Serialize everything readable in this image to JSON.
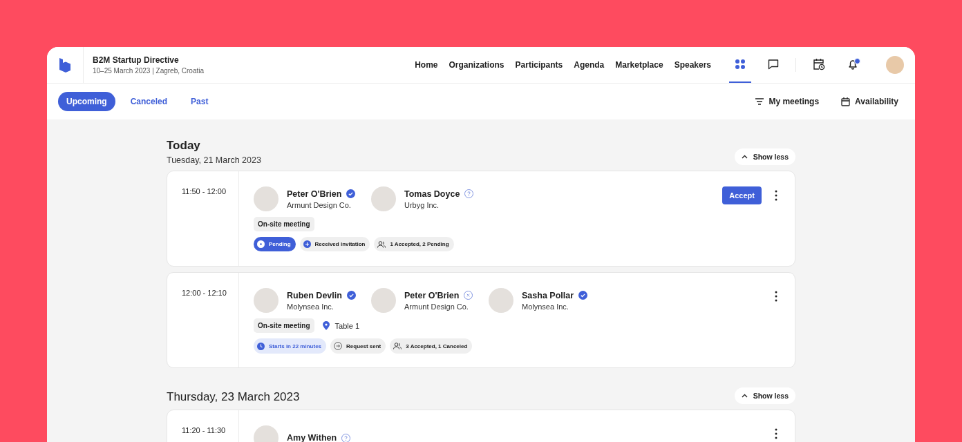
{
  "header": {
    "event_title": "B2M Startup Directive",
    "event_subtitle": "10–25 March 2023 | Zagreb, Croatia",
    "nav": [
      {
        "label": "Home"
      },
      {
        "label": "Organizations"
      },
      {
        "label": "Participants"
      },
      {
        "label": "Agenda"
      },
      {
        "label": "Marketplace"
      },
      {
        "label": "Speakers"
      }
    ],
    "icons": [
      {
        "kind": "grid",
        "selected": true,
        "badge": false
      },
      {
        "kind": "chat",
        "selected": false,
        "badge": false
      },
      {
        "kind": "calendar-clock",
        "selected": false,
        "badge": false
      },
      {
        "kind": "bell",
        "selected": false,
        "badge": true
      }
    ]
  },
  "tabs": [
    {
      "label": "Upcoming",
      "selected": true
    },
    {
      "label": "Canceled",
      "selected": false
    },
    {
      "label": "Past",
      "selected": false
    }
  ],
  "filters": [
    {
      "kind": "filter",
      "label": "My meetings"
    },
    {
      "kind": "calendar",
      "label": "Availability"
    }
  ],
  "sections": [
    {
      "kind": "today",
      "title": "Today",
      "subtitle": "Tuesday, 21 March 2023",
      "toggle": "Show less",
      "meetings": [
        {
          "time": "11:50 - 12:00",
          "participants": [
            {
              "name": "Peter O'Brien",
              "org": "Armunt Design Co.",
              "kind": "confirmed"
            },
            {
              "name": "Tomas Doyce",
              "org": "Urbyg Inc.",
              "kind": "pending"
            }
          ],
          "type": "On-site meeting",
          "chips": [
            {
              "kind": "pending",
              "label": "Pending"
            },
            {
              "kind": "invite",
              "label": "Received invitation"
            },
            {
              "kind": "people",
              "label": "1 Accepted, 2 Pending"
            }
          ],
          "actions": [
            "Accept"
          ]
        },
        {
          "time": "12:00 - 12:10",
          "participants": [
            {
              "name": "Ruben Devlin",
              "org": "Molynsea Inc.",
              "kind": "confirmed"
            },
            {
              "name": "Peter O'Brien",
              "org": "Armunt Design Co.",
              "kind": "declined"
            },
            {
              "name": "Sasha Pollar",
              "org": "Molynsea Inc.",
              "kind": "confirmed"
            }
          ],
          "type": "On-site meeting",
          "location": "Table 1",
          "chips": [
            {
              "kind": "timer",
              "label": "Starts in 22 minutes"
            },
            {
              "kind": "sent",
              "label": "Request sent"
            },
            {
              "kind": "people",
              "label": "3 Accepted, 1 Canceled"
            }
          ]
        }
      ]
    },
    {
      "kind": "date",
      "title": "Thursday, 23 March 2023",
      "toggle": "Show less",
      "meetings": [
        {
          "time": "11:20 - 11:30",
          "participants": [
            {
              "name": "Amy Withen",
              "kind": "pending"
            }
          ]
        }
      ]
    }
  ]
}
